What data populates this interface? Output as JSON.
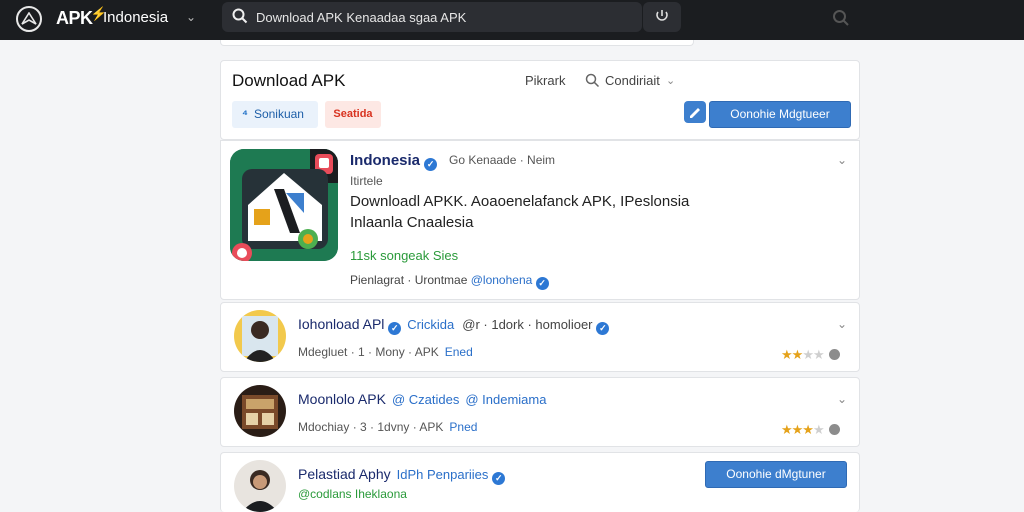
{
  "topbar": {
    "brand": "APK",
    "region": "Indonesia",
    "search": {
      "value": "Download APK Kenaadaa sgaa APK",
      "placeholder": ""
    }
  },
  "header": {
    "title": "Download APK",
    "filter_label": "Pikrark",
    "sort_label": "Condiriait",
    "chip_blue": "Sonikuan",
    "chip_red": "Seatida",
    "download_button": "Oonohie Mdgtueer"
  },
  "featured": {
    "name": "Indonesia",
    "meta": "Go Kenaade · Neim",
    "sub": "Itirtele",
    "description": "Downloadl APKK. Aoaoenelafanck APK, IPeslonsia Inlaanla Cnaalesia",
    "tag": "11sk songeak Sies",
    "footer_text": "Pienlagrat · Urontmae",
    "footer_handle": "@lonohena"
  },
  "list": [
    {
      "name": "Iohonload APl",
      "tag": "Crickida",
      "tag2": "@r · 1dork · homolioer",
      "meta": "Mdegluet · 1 · Mony · APK",
      "pill": "Ened",
      "rating": 2
    },
    {
      "name": "Moonlolo APK",
      "tag": "@ Czatides",
      "tag2": "@ Indemiama",
      "meta": "Mdochiay · 3 · 1dvny · APK",
      "pill": "Pned",
      "rating": 3
    },
    {
      "name": "Pelastiad Aphy",
      "tag": "IdPh Penpariies",
      "handle": "@codlans Iheklaona",
      "button": "Oonohie dMgtuner"
    }
  ],
  "colors": {
    "topbar": "#1b1d20",
    "accent": "#3d7fce",
    "brand_green": "#3ec04a",
    "star": "#e5a21a"
  }
}
